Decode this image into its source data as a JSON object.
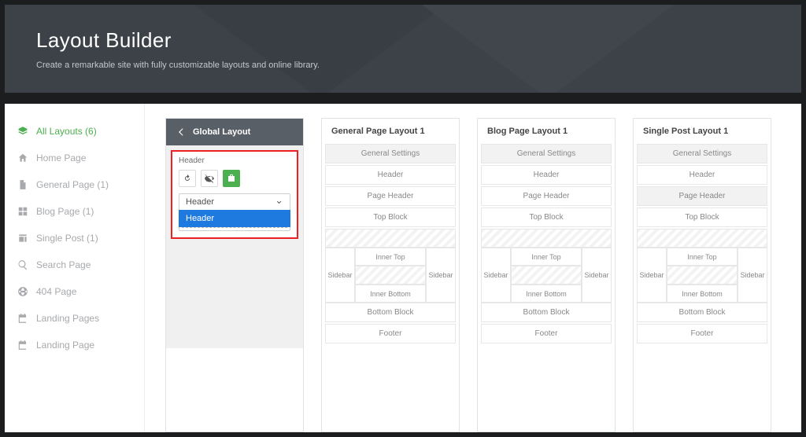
{
  "hero": {
    "title": "Layout Builder",
    "subtitle": "Create a remarkable site with fully customizable layouts and online library."
  },
  "sidebar": {
    "items": [
      {
        "label": "All Layouts (6)",
        "icon": "layers"
      },
      {
        "label": "Home Page",
        "icon": "home"
      },
      {
        "label": "General Page (1)",
        "icon": "file"
      },
      {
        "label": "Blog Page (1)",
        "icon": "grid"
      },
      {
        "label": "Single Post (1)",
        "icon": "post"
      },
      {
        "label": "Search Page",
        "icon": "search"
      },
      {
        "label": "404 Page",
        "icon": "globe"
      },
      {
        "label": "Landing Pages",
        "icon": "calendar"
      },
      {
        "label": "Landing Page",
        "icon": "calendar"
      }
    ],
    "active_index": 0
  },
  "global_card": {
    "title": "Global Layout",
    "panel_label": "Header",
    "select_value": "Header",
    "select_open_option": "Header"
  },
  "preview_slots": {
    "general": "General Settings",
    "header": "Header",
    "page_header": "Page Header",
    "top_block": "Top Block",
    "sidebar": "Sidebar",
    "inner_top": "Inner Top",
    "inner_bottom": "Inner Bottom",
    "bottom_block": "Bottom Block",
    "footer": "Footer"
  },
  "layout_cards": [
    {
      "title": "General Page Layout 1",
      "gray_page_header": false
    },
    {
      "title": "Blog Page Layout 1",
      "gray_page_header": false
    },
    {
      "title": "Single Post Layout 1",
      "gray_page_header": true
    }
  ],
  "icons": {
    "refresh": "refresh-icon",
    "eyeoff": "hide-icon",
    "briefcase": "briefcase-icon",
    "back": "back-arrow-icon"
  }
}
